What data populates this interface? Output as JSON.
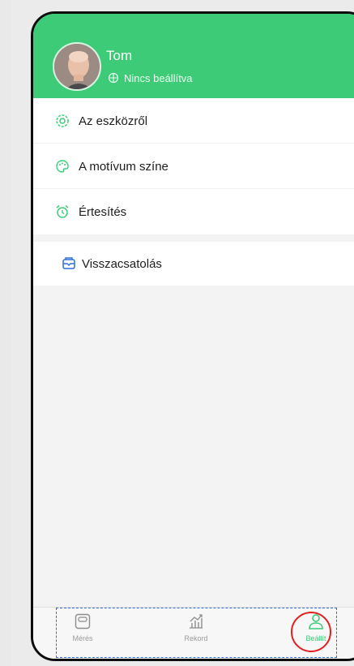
{
  "profile": {
    "name": "Tom",
    "region": "Nincs beállítva"
  },
  "menu_group_1": [
    {
      "label": "Az eszközről",
      "icon": "gear-icon"
    },
    {
      "label": "A motívum színe",
      "icon": "palette-icon"
    },
    {
      "label": "Értesítés",
      "icon": "alarm-clock-icon"
    }
  ],
  "menu_group_2": [
    {
      "label": "Visszacsatolás",
      "icon": "feedback-icon"
    }
  ],
  "tabbar": {
    "measure_label": "Mérés",
    "record_label": "Rekord",
    "settings_label": "Beállít",
    "active_tab": "settings"
  },
  "colors": {
    "accent": "#3ecb78",
    "annotation_box": "#2e6bd8",
    "annotation_circle": "#e02020"
  }
}
